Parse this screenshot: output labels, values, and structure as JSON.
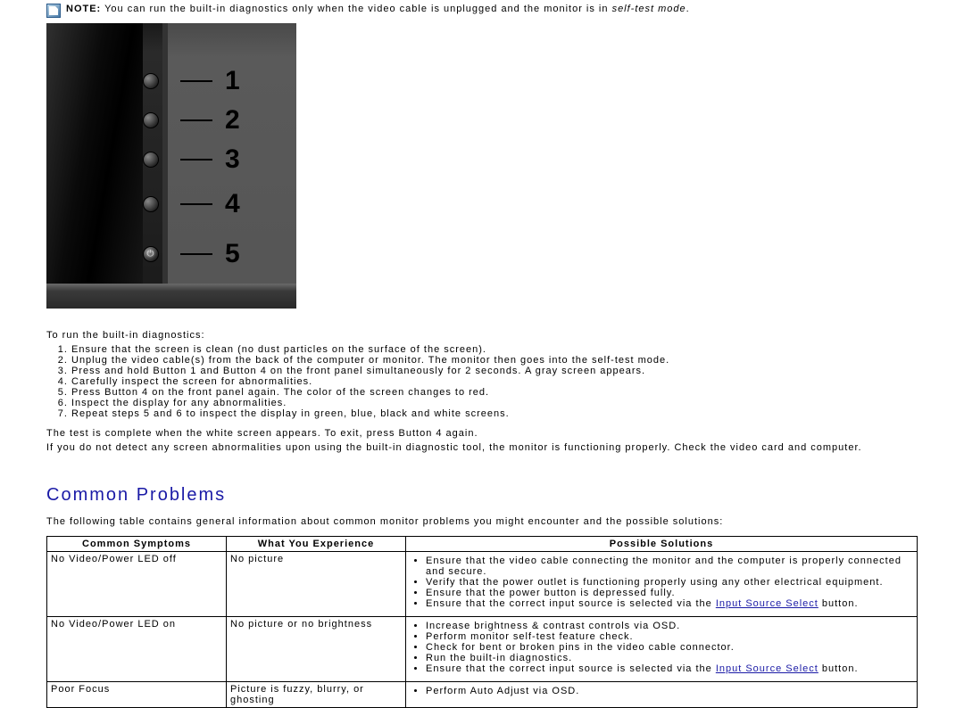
{
  "note": {
    "label": "NOTE:",
    "text_before": "You can run the built-in diagnostics only when the video cable is unplugged and the monitor is in ",
    "italic": "self-test mode",
    "text_after": "."
  },
  "figure": {
    "labels": [
      "1",
      "2",
      "3",
      "4",
      "5"
    ]
  },
  "diag": {
    "lead": "To run the built-in diagnostics:",
    "steps": [
      "Ensure that the screen is clean (no dust particles on the surface of the screen).",
      "Unplug the video cable(s) from the back of the computer or monitor. The monitor then goes into the self-test mode.",
      "Press and hold Button 1 and Button 4 on the front panel simultaneously for 2 seconds. A gray screen appears.",
      "Carefully inspect the screen for abnormalities.",
      "Press Button 4 on the front panel again. The color of the screen changes to red.",
      "Inspect the display for any abnormalities.",
      "Repeat steps 5 and 6 to inspect the display in green, blue, black and white screens."
    ],
    "after1": "The test is complete when the white screen appears. To exit, press Button 4 again.",
    "after2": "If you do not detect any screen abnormalities upon using the built-in diagnostic tool, the monitor is functioning properly. Check the video card and computer."
  },
  "section_heading": "Common Problems",
  "section_intro": "The following table contains general information about common monitor problems you might encounter and the possible solutions:",
  "table": {
    "headers": [
      "Common Symptoms",
      "What You Experience",
      "Possible Solutions"
    ],
    "rows": [
      {
        "symptom": "No Video/Power LED off",
        "experience": "No picture",
        "solutions": [
          "Ensure that the video cable connecting the monitor and the computer is properly connected and secure.",
          "Verify that the power outlet is functioning properly using any other electrical equipment.",
          "Ensure that the power button is depressed fully."
        ],
        "link_prefix": "Ensure that the correct input source is selected via the ",
        "link_text": "Input Source Select",
        "link_suffix": " button."
      },
      {
        "symptom": "No Video/Power LED on",
        "experience": "No picture or no brightness",
        "solutions": [
          "Increase brightness & contrast controls via OSD.",
          "Perform monitor self-test feature check.",
          "Check for bent or broken pins in the video cable connector.",
          "Run the built-in diagnostics."
        ],
        "link_prefix": "Ensure that the correct input source is selected via the ",
        "link_text": "Input Source Select",
        "link_suffix": " button."
      },
      {
        "symptom": "Poor Focus",
        "experience": "Picture is fuzzy, blurry, or ghosting",
        "solutions": [
          "Perform Auto Adjust via OSD."
        ],
        "link_prefix": "",
        "link_text": "",
        "link_suffix": ""
      }
    ]
  }
}
